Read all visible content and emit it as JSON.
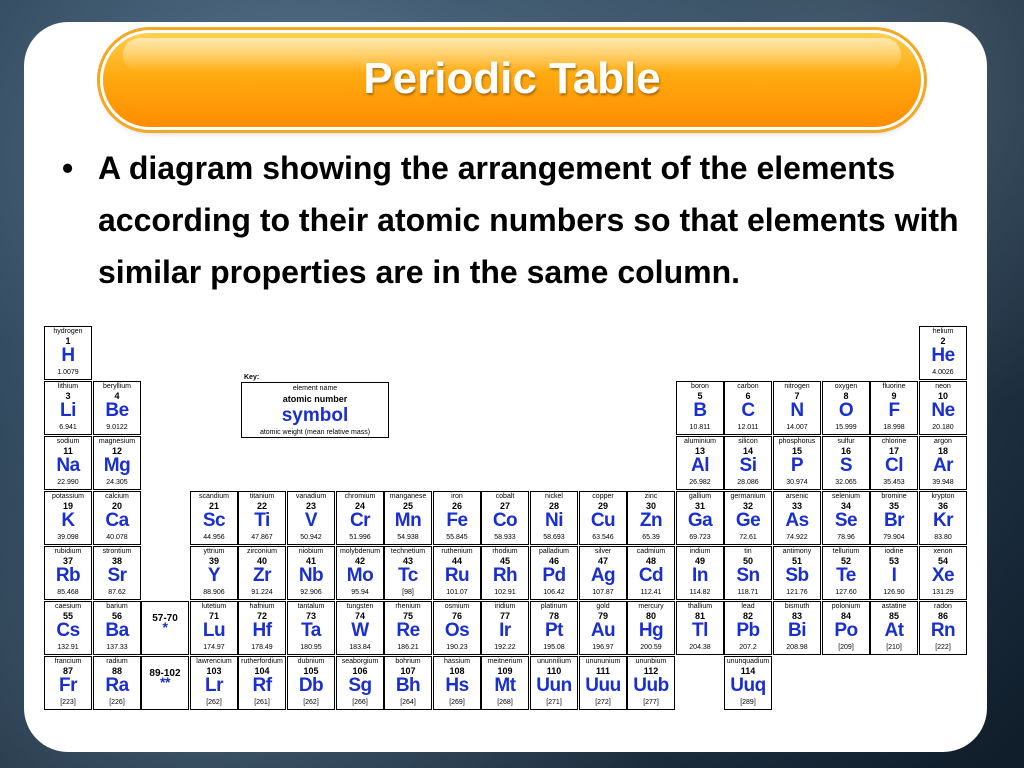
{
  "slide": {
    "title": "Periodic Table",
    "bullet_char": "•",
    "bullet_text": "A diagram showing the arrangement of the elements according to their atomic numbers so that elements with similar properties are in the same column."
  },
  "key": {
    "label": "Key:",
    "element_name": "element name",
    "atomic_number": "atomic number",
    "symbol": "symbol",
    "atomic_weight": "atomic weight (mean relative mass)"
  },
  "elements": [
    {
      "name": "hydrogen",
      "num": "1",
      "sym": "H",
      "wt": "1.0079",
      "row": 0,
      "col": 0
    },
    {
      "name": "helium",
      "num": "2",
      "sym": "He",
      "wt": "4.0026",
      "row": 0,
      "col": 18
    },
    {
      "name": "lithium",
      "num": "3",
      "sym": "Li",
      "wt": "6.941",
      "row": 1,
      "col": 0
    },
    {
      "name": "beryllium",
      "num": "4",
      "sym": "Be",
      "wt": "9.0122",
      "row": 1,
      "col": 1
    },
    {
      "name": "boron",
      "num": "5",
      "sym": "B",
      "wt": "10.811",
      "row": 1,
      "col": 13
    },
    {
      "name": "carbon",
      "num": "6",
      "sym": "C",
      "wt": "12.011",
      "row": 1,
      "col": 14
    },
    {
      "name": "nitrogen",
      "num": "7",
      "sym": "N",
      "wt": "14.007",
      "row": 1,
      "col": 15
    },
    {
      "name": "oxygen",
      "num": "8",
      "sym": "O",
      "wt": "15.999",
      "row": 1,
      "col": 16
    },
    {
      "name": "fluorine",
      "num": "9",
      "sym": "F",
      "wt": "18.998",
      "row": 1,
      "col": 17
    },
    {
      "name": "neon",
      "num": "10",
      "sym": "Ne",
      "wt": "20.180",
      "row": 1,
      "col": 18
    },
    {
      "name": "sodium",
      "num": "11",
      "sym": "Na",
      "wt": "22.990",
      "row": 2,
      "col": 0
    },
    {
      "name": "magnesium",
      "num": "12",
      "sym": "Mg",
      "wt": "24.305",
      "row": 2,
      "col": 1
    },
    {
      "name": "aluminium",
      "num": "13",
      "sym": "Al",
      "wt": "26.982",
      "row": 2,
      "col": 13
    },
    {
      "name": "silicon",
      "num": "14",
      "sym": "Si",
      "wt": "28.086",
      "row": 2,
      "col": 14
    },
    {
      "name": "phosphorus",
      "num": "15",
      "sym": "P",
      "wt": "30.974",
      "row": 2,
      "col": 15
    },
    {
      "name": "sulfur",
      "num": "16",
      "sym": "S",
      "wt": "32.065",
      "row": 2,
      "col": 16
    },
    {
      "name": "chlorine",
      "num": "17",
      "sym": "Cl",
      "wt": "35.453",
      "row": 2,
      "col": 17
    },
    {
      "name": "argon",
      "num": "18",
      "sym": "Ar",
      "wt": "39.948",
      "row": 2,
      "col": 18
    },
    {
      "name": "potassium",
      "num": "19",
      "sym": "K",
      "wt": "39.098",
      "row": 3,
      "col": 0
    },
    {
      "name": "calcium",
      "num": "20",
      "sym": "Ca",
      "wt": "40.078",
      "row": 3,
      "col": 1
    },
    {
      "name": "scandium",
      "num": "21",
      "sym": "Sc",
      "wt": "44.956",
      "row": 3,
      "col": 3
    },
    {
      "name": "titanium",
      "num": "22",
      "sym": "Ti",
      "wt": "47.867",
      "row": 3,
      "col": 4
    },
    {
      "name": "vanadium",
      "num": "23",
      "sym": "V",
      "wt": "50.942",
      "row": 3,
      "col": 5
    },
    {
      "name": "chromium",
      "num": "24",
      "sym": "Cr",
      "wt": "51.996",
      "row": 3,
      "col": 6
    },
    {
      "name": "manganese",
      "num": "25",
      "sym": "Mn",
      "wt": "54.938",
      "row": 3,
      "col": 7
    },
    {
      "name": "iron",
      "num": "26",
      "sym": "Fe",
      "wt": "55.845",
      "row": 3,
      "col": 8
    },
    {
      "name": "cobalt",
      "num": "27",
      "sym": "Co",
      "wt": "58.933",
      "row": 3,
      "col": 9
    },
    {
      "name": "nickel",
      "num": "28",
      "sym": "Ni",
      "wt": "58.693",
      "row": 3,
      "col": 10
    },
    {
      "name": "copper",
      "num": "29",
      "sym": "Cu",
      "wt": "63.546",
      "row": 3,
      "col": 11
    },
    {
      "name": "zinc",
      "num": "30",
      "sym": "Zn",
      "wt": "65.39",
      "row": 3,
      "col": 12
    },
    {
      "name": "gallium",
      "num": "31",
      "sym": "Ga",
      "wt": "69.723",
      "row": 3,
      "col": 13
    },
    {
      "name": "germanium",
      "num": "32",
      "sym": "Ge",
      "wt": "72.61",
      "row": 3,
      "col": 14
    },
    {
      "name": "arsenic",
      "num": "33",
      "sym": "As",
      "wt": "74.922",
      "row": 3,
      "col": 15
    },
    {
      "name": "selenium",
      "num": "34",
      "sym": "Se",
      "wt": "78.96",
      "row": 3,
      "col": 16
    },
    {
      "name": "bromine",
      "num": "35",
      "sym": "Br",
      "wt": "79.904",
      "row": 3,
      "col": 17
    },
    {
      "name": "krypton",
      "num": "36",
      "sym": "Kr",
      "wt": "83.80",
      "row": 3,
      "col": 18
    },
    {
      "name": "rubidium",
      "num": "37",
      "sym": "Rb",
      "wt": "85.468",
      "row": 4,
      "col": 0
    },
    {
      "name": "strontium",
      "num": "38",
      "sym": "Sr",
      "wt": "87.62",
      "row": 4,
      "col": 1
    },
    {
      "name": "yttrium",
      "num": "39",
      "sym": "Y",
      "wt": "88.906",
      "row": 4,
      "col": 3
    },
    {
      "name": "zirconium",
      "num": "40",
      "sym": "Zr",
      "wt": "91.224",
      "row": 4,
      "col": 4
    },
    {
      "name": "niobium",
      "num": "41",
      "sym": "Nb",
      "wt": "92.906",
      "row": 4,
      "col": 5
    },
    {
      "name": "molybdenum",
      "num": "42",
      "sym": "Mo",
      "wt": "95.94",
      "row": 4,
      "col": 6
    },
    {
      "name": "technetium",
      "num": "43",
      "sym": "Tc",
      "wt": "[98]",
      "row": 4,
      "col": 7
    },
    {
      "name": "ruthenium",
      "num": "44",
      "sym": "Ru",
      "wt": "101.07",
      "row": 4,
      "col": 8
    },
    {
      "name": "rhodium",
      "num": "45",
      "sym": "Rh",
      "wt": "102.91",
      "row": 4,
      "col": 9
    },
    {
      "name": "palladium",
      "num": "46",
      "sym": "Pd",
      "wt": "106.42",
      "row": 4,
      "col": 10
    },
    {
      "name": "silver",
      "num": "47",
      "sym": "Ag",
      "wt": "107.87",
      "row": 4,
      "col": 11
    },
    {
      "name": "cadmium",
      "num": "48",
      "sym": "Cd",
      "wt": "112.41",
      "row": 4,
      "col": 12
    },
    {
      "name": "indium",
      "num": "49",
      "sym": "In",
      "wt": "114.82",
      "row": 4,
      "col": 13
    },
    {
      "name": "tin",
      "num": "50",
      "sym": "Sn",
      "wt": "118.71",
      "row": 4,
      "col": 14
    },
    {
      "name": "antimony",
      "num": "51",
      "sym": "Sb",
      "wt": "121.76",
      "row": 4,
      "col": 15
    },
    {
      "name": "tellurium",
      "num": "52",
      "sym": "Te",
      "wt": "127.60",
      "row": 4,
      "col": 16
    },
    {
      "name": "iodine",
      "num": "53",
      "sym": "I",
      "wt": "126.90",
      "row": 4,
      "col": 17
    },
    {
      "name": "xenon",
      "num": "54",
      "sym": "Xe",
      "wt": "131.29",
      "row": 4,
      "col": 18
    },
    {
      "name": "caesium",
      "num": "55",
      "sym": "Cs",
      "wt": "132.91",
      "row": 5,
      "col": 0
    },
    {
      "name": "barium",
      "num": "56",
      "sym": "Ba",
      "wt": "137.33",
      "row": 5,
      "col": 1
    },
    {
      "name": "",
      "num": "57-70",
      "sym": "*",
      "wt": "",
      "row": 5,
      "col": 2,
      "ph": true
    },
    {
      "name": "lutetium",
      "num": "71",
      "sym": "Lu",
      "wt": "174.97",
      "row": 5,
      "col": 3
    },
    {
      "name": "hafnium",
      "num": "72",
      "sym": "Hf",
      "wt": "178.49",
      "row": 5,
      "col": 4
    },
    {
      "name": "tantalum",
      "num": "73",
      "sym": "Ta",
      "wt": "180.95",
      "row": 5,
      "col": 5
    },
    {
      "name": "tungsten",
      "num": "74",
      "sym": "W",
      "wt": "183.84",
      "row": 5,
      "col": 6
    },
    {
      "name": "rhenium",
      "num": "75",
      "sym": "Re",
      "wt": "186.21",
      "row": 5,
      "col": 7
    },
    {
      "name": "osmium",
      "num": "76",
      "sym": "Os",
      "wt": "190.23",
      "row": 5,
      "col": 8
    },
    {
      "name": "iridium",
      "num": "77",
      "sym": "Ir",
      "wt": "192.22",
      "row": 5,
      "col": 9
    },
    {
      "name": "platinum",
      "num": "78",
      "sym": "Pt",
      "wt": "195.08",
      "row": 5,
      "col": 10
    },
    {
      "name": "gold",
      "num": "79",
      "sym": "Au",
      "wt": "196.97",
      "row": 5,
      "col": 11
    },
    {
      "name": "mercury",
      "num": "80",
      "sym": "Hg",
      "wt": "200.59",
      "row": 5,
      "col": 12
    },
    {
      "name": "thallium",
      "num": "81",
      "sym": "Tl",
      "wt": "204.38",
      "row": 5,
      "col": 13
    },
    {
      "name": "lead",
      "num": "82",
      "sym": "Pb",
      "wt": "207.2",
      "row": 5,
      "col": 14
    },
    {
      "name": "bismuth",
      "num": "83",
      "sym": "Bi",
      "wt": "208.98",
      "row": 5,
      "col": 15
    },
    {
      "name": "polonium",
      "num": "84",
      "sym": "Po",
      "wt": "[209]",
      "row": 5,
      "col": 16
    },
    {
      "name": "astatine",
      "num": "85",
      "sym": "At",
      "wt": "[210]",
      "row": 5,
      "col": 17
    },
    {
      "name": "radon",
      "num": "86",
      "sym": "Rn",
      "wt": "[222]",
      "row": 5,
      "col": 18
    },
    {
      "name": "francium",
      "num": "87",
      "sym": "Fr",
      "wt": "[223]",
      "row": 6,
      "col": 0
    },
    {
      "name": "radium",
      "num": "88",
      "sym": "Ra",
      "wt": "[226]",
      "row": 6,
      "col": 1
    },
    {
      "name": "",
      "num": "89-102",
      "sym": "**",
      "wt": "",
      "row": 6,
      "col": 2,
      "ph": true
    },
    {
      "name": "lawrencium",
      "num": "103",
      "sym": "Lr",
      "wt": "[262]",
      "row": 6,
      "col": 3
    },
    {
      "name": "rutherfordium",
      "num": "104",
      "sym": "Rf",
      "wt": "[261]",
      "row": 6,
      "col": 4
    },
    {
      "name": "dubnium",
      "num": "105",
      "sym": "Db",
      "wt": "[262]",
      "row": 6,
      "col": 5
    },
    {
      "name": "seaborgium",
      "num": "106",
      "sym": "Sg",
      "wt": "[266]",
      "row": 6,
      "col": 6
    },
    {
      "name": "bohrium",
      "num": "107",
      "sym": "Bh",
      "wt": "[264]",
      "row": 6,
      "col": 7
    },
    {
      "name": "hassium",
      "num": "108",
      "sym": "Hs",
      "wt": "[269]",
      "row": 6,
      "col": 8
    },
    {
      "name": "meitnerium",
      "num": "109",
      "sym": "Mt",
      "wt": "[268]",
      "row": 6,
      "col": 9
    },
    {
      "name": "ununnilium",
      "num": "110",
      "sym": "Uun",
      "wt": "[271]",
      "row": 6,
      "col": 10
    },
    {
      "name": "unununium",
      "num": "111",
      "sym": "Uuu",
      "wt": "[272]",
      "row": 6,
      "col": 11
    },
    {
      "name": "ununbium",
      "num": "112",
      "sym": "Uub",
      "wt": "[277]",
      "row": 6,
      "col": 12
    },
    {
      "name": "ununquadium",
      "num": "114",
      "sym": "Uuq",
      "wt": "[289]",
      "row": 6,
      "col": 14
    }
  ],
  "colors": {
    "title_orange": "#ffaa10",
    "symbol_blue": "#1a2fd0"
  }
}
